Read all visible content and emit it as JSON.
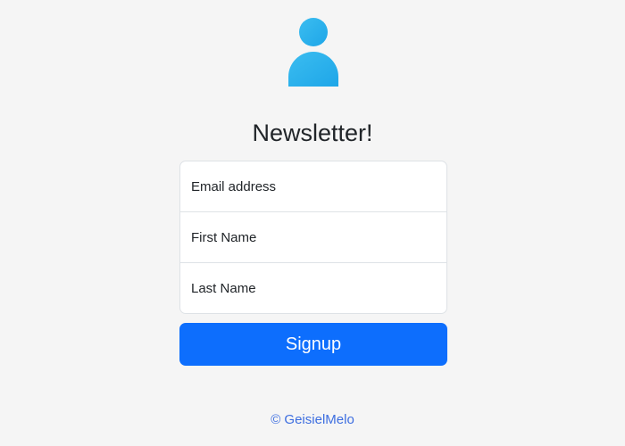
{
  "header": {
    "icon": "user-icon",
    "title": "Newsletter!"
  },
  "form": {
    "email_placeholder": "Email address",
    "first_name_placeholder": "First Name",
    "last_name_placeholder": "Last Name",
    "submit_label": "Signup"
  },
  "footer": {
    "text": "© GeisielMelo"
  },
  "colors": {
    "background": "#f5f5f5",
    "icon_accent": "#2eb4ec",
    "button": "#0d6efd",
    "footer_link": "#3d6ee0"
  }
}
